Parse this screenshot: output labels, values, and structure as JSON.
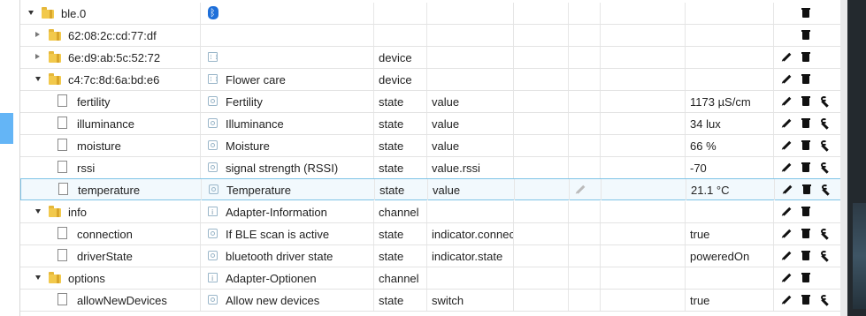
{
  "rows": [
    {
      "name": "ble.0",
      "label": "",
      "type": "",
      "role": "",
      "value": "",
      "icon": "bluetooth-icon"
    },
    {
      "name": "62:08:2c:cd:77:df",
      "label": "",
      "type": "",
      "role": "",
      "value": "",
      "icon": "none"
    },
    {
      "name": "6e:d9:ab:5c:52:72",
      "label": "",
      "type": "device",
      "role": "",
      "value": "",
      "icon": "device-icon"
    },
    {
      "name": "c4:7c:8d:6a:bd:e6",
      "label": "Flower care",
      "type": "device",
      "role": "",
      "value": "",
      "icon": "device-icon"
    },
    {
      "name": "fertility",
      "label": "Fertility",
      "type": "state",
      "role": "value",
      "value": "1173 µS/cm",
      "icon": "state-icon"
    },
    {
      "name": "illuminance",
      "label": "Illuminance",
      "type": "state",
      "role": "value",
      "value": "34 lux",
      "icon": "state-icon"
    },
    {
      "name": "moisture",
      "label": "Moisture",
      "type": "state",
      "role": "value",
      "value": "66 %",
      "icon": "state-icon"
    },
    {
      "name": "rssi",
      "label": "signal strength (RSSI)",
      "type": "state",
      "role": "value.rssi",
      "value": "-70",
      "icon": "state-icon"
    },
    {
      "name": "temperature",
      "label": "Temperature",
      "type": "state",
      "role": "value",
      "value": "21.1 °C",
      "icon": "state-icon"
    },
    {
      "name": "info",
      "label": "Adapter-Information",
      "type": "channel",
      "role": "",
      "value": "",
      "icon": "info-icon"
    },
    {
      "name": "connection",
      "label": "If BLE scan is active",
      "type": "state",
      "role": "indicator.connected",
      "value": "true",
      "icon": "state-icon"
    },
    {
      "name": "driverState",
      "label": "bluetooth driver state",
      "type": "state",
      "role": "indicator.state",
      "value": "poweredOn",
      "icon": "state-icon"
    },
    {
      "name": "options",
      "label": "Adapter-Optionen",
      "type": "channel",
      "role": "",
      "value": "",
      "icon": "info-icon"
    },
    {
      "name": "allowNewDevices",
      "label": "Allow new devices",
      "type": "state",
      "role": "switch",
      "value": "true",
      "icon": "state-icon"
    }
  ],
  "colors": {
    "selection_bg": "#f2f9fd",
    "selection_border": "#7ec3e6",
    "folder": "#f2c94c",
    "accent_tab": "#64b5f6",
    "bluetooth": "#1e6fd9"
  },
  "action_icons": [
    "pencil-icon",
    "trash-icon",
    "wrench-icon"
  ]
}
